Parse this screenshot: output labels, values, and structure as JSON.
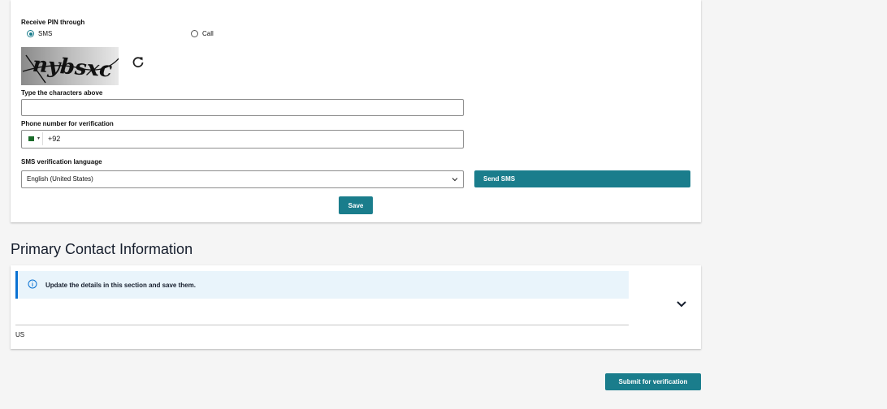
{
  "pin_section": {
    "receive_label": "Receive PIN through",
    "options": [
      {
        "label": "SMS",
        "selected": true
      },
      {
        "label": "Call",
        "selected": false
      }
    ],
    "captcha_text": "nybsxc",
    "captcha_icon": "refresh-icon",
    "captcha_input": {
      "label": "Type the characters above",
      "value": ""
    },
    "phone": {
      "label": "Phone number for verification",
      "country_flag": "flag-icon",
      "code": "+92"
    },
    "language": {
      "label": "SMS verification language",
      "selected": "English (United States)"
    },
    "send_sms_label": "Send SMS",
    "save_label": "Save"
  },
  "primary_contact": {
    "title": "Primary Contact Information",
    "info_message": "Update the details in this section and save them.",
    "country_value": "US"
  },
  "submit_label": "Submit for verification",
  "colors": {
    "accent": "#1a7d8c",
    "info_border": "#0972d3",
    "info_bg": "#e9f4fb"
  }
}
